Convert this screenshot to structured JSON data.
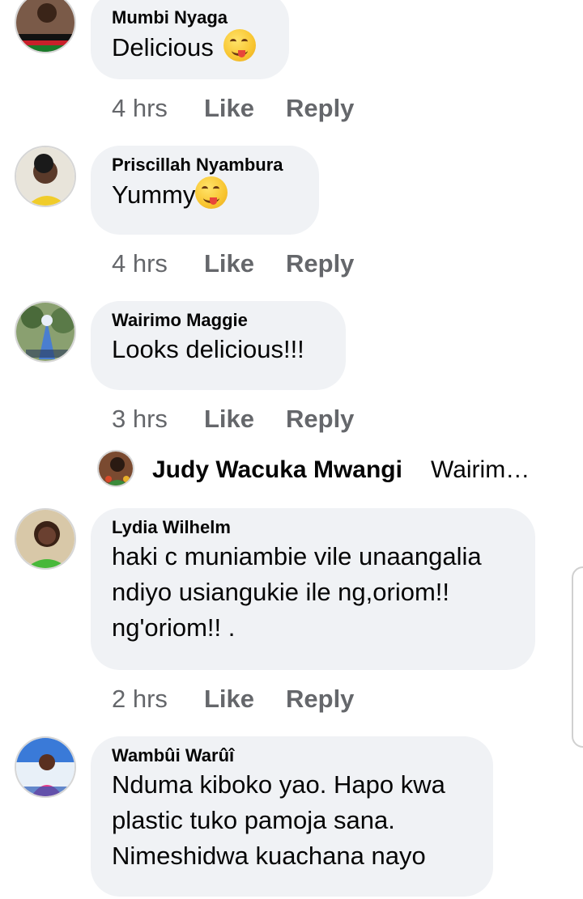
{
  "comments": [
    {
      "name": "Mumbi Nyaga",
      "text": "Delicious",
      "emoji": "face-savoring-food-icon",
      "time": "4 hrs",
      "like": "Like",
      "reply": "Reply"
    },
    {
      "name": "Priscillah Nyambura",
      "text": "Yummy",
      "emoji": "face-savoring-food-icon",
      "time": "4 hrs",
      "like": "Like",
      "reply": "Reply"
    },
    {
      "name": "Wairimo Maggie",
      "text": "Looks delicious!!!",
      "time": "3 hrs",
      "like": "Like",
      "reply": "Reply"
    },
    {
      "name": "Lydia Wilhelm",
      "text": "haki c muniambie vile unaangalia\nndiyo usiangukie ile ng,oriom!!\nng'oriom!! .",
      "time": "2 hrs",
      "like": "Like",
      "reply": "Reply"
    },
    {
      "name": "Wambûi Warûî",
      "text": "Nduma kiboko yao. Hapo kwa\nplastic tuko pamoja sana.\nNimeshidwa kuachana nayo"
    }
  ],
  "reply_preview": {
    "name": "Judy Wacuka Mwangi",
    "text": "Wairim…"
  },
  "colors": {
    "bubble": "#f0f2f5",
    "meta": "#65676b",
    "text": "#050505"
  }
}
